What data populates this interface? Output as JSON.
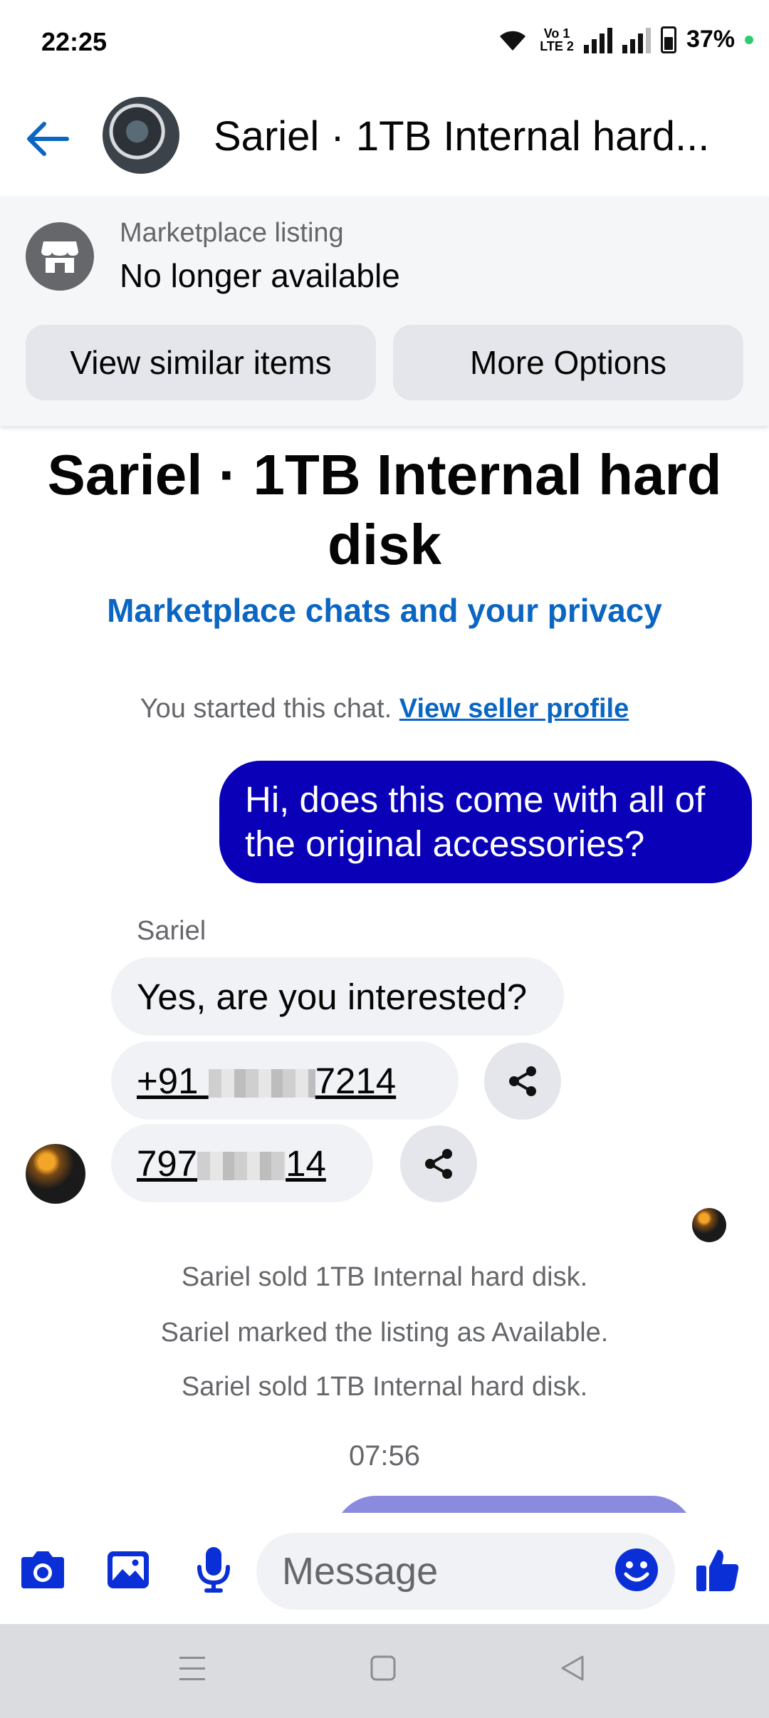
{
  "status_bar": {
    "time": "22:25",
    "volte_top": "Vo 1",
    "volte_bottom": "LTE 2",
    "battery": "37%"
  },
  "header": {
    "title": "Sariel · 1TB Internal hard..."
  },
  "banner": {
    "label": "Marketplace listing",
    "status": "No longer available",
    "btn_similar": "View similar items",
    "btn_more": "More Options"
  },
  "chat": {
    "title": "Sariel · 1TB Internal hard disk",
    "privacy_link": "Marketplace chats and your privacy",
    "started_text": "You started this chat.",
    "seller_link": "View seller profile",
    "outgoing_message": "Hi, does this come with all of the original accessories?",
    "sender_name": "Sariel",
    "reply": "Yes, are you interested?",
    "phone1_prefix": "+91 ",
    "phone1_suffix": "7214",
    "phone2_prefix": "797",
    "phone2_suffix": "14",
    "events": [
      "Sariel sold 1TB Internal hard disk.",
      "Sariel marked the listing as Available.",
      "Sariel sold 1TB Internal hard disk."
    ],
    "timestamp": "07:56"
  },
  "composer": {
    "placeholder": "Message"
  },
  "colors": {
    "accent": "#0a66c2",
    "outgoing_bubble": "#0a00b8",
    "composer_icon": "#0a2fd6"
  }
}
